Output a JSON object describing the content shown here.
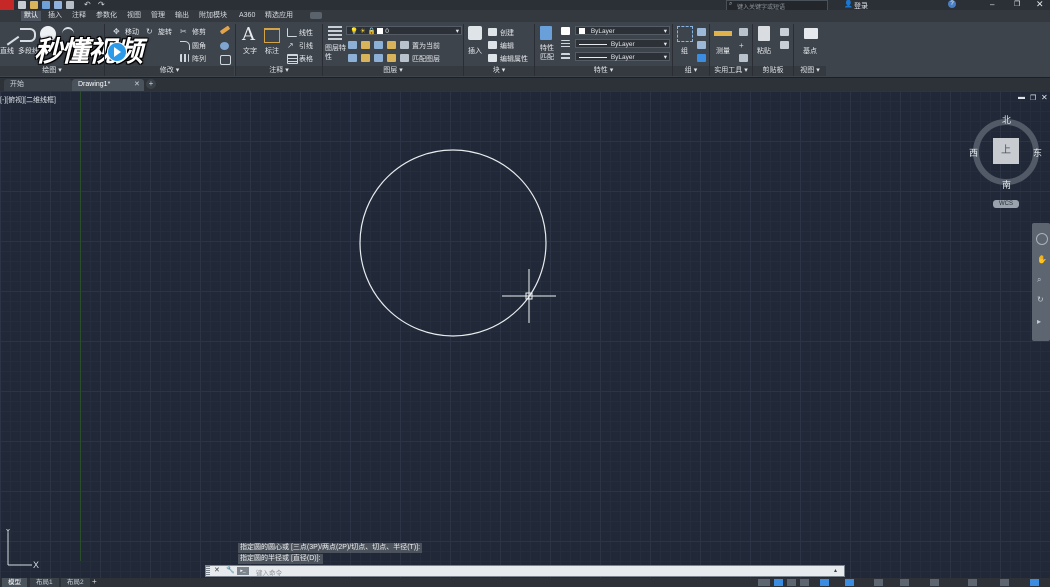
{
  "title_bar": {
    "search_placeholder": "键入关键字或短语",
    "login_label": "登录"
  },
  "menu_tabs": [
    "默认",
    "插入",
    "注释",
    "参数化",
    "视图",
    "管理",
    "输出",
    "附加模块",
    "A360",
    "精选应用"
  ],
  "ribbon": {
    "draw": {
      "label": "绘图",
      "line": "直线",
      "polyline": "多段线"
    },
    "modify": {
      "label": "修改",
      "move": "移动",
      "rotate": "旋转",
      "trim": "修剪",
      "fillet": "圆角",
      "array": "阵列"
    },
    "annotation": {
      "label": "注释",
      "text": "文字",
      "dimension": "标注",
      "linear": "线性",
      "leader": "引线",
      "table": "表格"
    },
    "layers": {
      "label": "图层",
      "layer_props": "图层特性",
      "current_layer": "0",
      "set_current": "置为当前",
      "match_layer": "匹配图层"
    },
    "block": {
      "label": "块",
      "insert": "插入",
      "create": "创建",
      "edit": "编辑",
      "edit_attr": "编辑属性"
    },
    "properties": {
      "label": "特性",
      "match_props": "特性匹配",
      "color": "ByLayer",
      "linetype": "ByLayer",
      "lineweight": "ByLayer"
    },
    "groups": {
      "label": "组",
      "group": "组"
    },
    "utilities": {
      "label": "实用工具",
      "measure": "测量"
    },
    "clipboard": {
      "label": "剪贴板",
      "paste": "粘贴"
    },
    "view": {
      "label": "视图",
      "base": "基点"
    }
  },
  "file_tabs": [
    "开始",
    "Drawing1*"
  ],
  "viewport_label": "[-][俯视][二维线框]",
  "watermark": "秒懂视频",
  "viewcube": {
    "north": "北",
    "south": "南",
    "east": "东",
    "west": "西",
    "face": "上",
    "wcs": "WCS"
  },
  "command_history": [
    "指定圆的圆心或 [三点(3P)/两点(2P)/切点、切点、半径(T)]:",
    "指定圆的半径或 [直径(D)]:"
  ],
  "command_placeholder": "键入命令",
  "layout_tabs": [
    "模型",
    "布局1",
    "布局2"
  ],
  "colors": {
    "canvas_bg": "#212837",
    "ribbon_bg": "#3e444c",
    "circle_stroke": "#e8ecef",
    "accent_blue": "#3a8de0",
    "brand_red": "#d12f2f"
  }
}
